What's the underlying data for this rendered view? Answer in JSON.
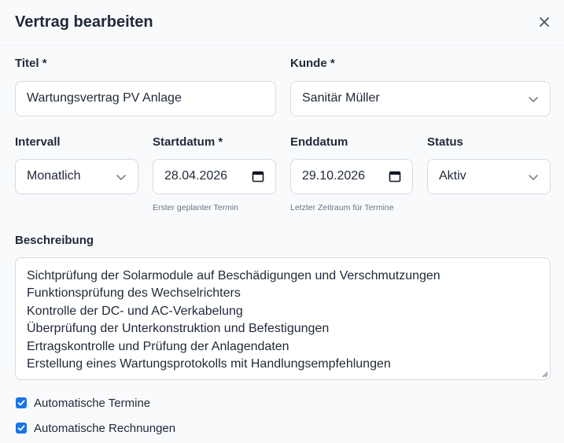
{
  "dialog": {
    "title": "Vertrag bearbeiten"
  },
  "form": {
    "titel": {
      "label": "Titel *",
      "value": "Wartungsvertrag PV Anlage"
    },
    "kunde": {
      "label": "Kunde *",
      "value": "Sanitär Müller"
    },
    "intervall": {
      "label": "Intervall",
      "value": "Monatlich"
    },
    "startdatum": {
      "label": "Startdatum *",
      "value": "28.04.2026",
      "hint": "Erster geplanter Termin"
    },
    "enddatum": {
      "label": "Enddatum",
      "value": "29.10.2026",
      "hint": "Letzter Zeitraum für Termine"
    },
    "status": {
      "label": "Status",
      "value": "Aktiv"
    },
    "beschreibung": {
      "label": "Beschreibung",
      "lines": [
        "Sichtprüfung der Solarmodule auf Beschädigungen und Verschmutzungen",
        "Funktionsprüfung des Wechselrichters",
        "Kontrolle der DC- und AC-Verkabelung",
        "Überprüfung der Unterkonstruktion und Befestigungen",
        "Ertragskontrolle und Prüfung der Anlagendaten",
        "Erstellung eines Wartungsprotokolls mit Handlungsempfehlungen"
      ]
    },
    "checkboxes": {
      "automatische_termine": {
        "label": "Automatische Termine",
        "checked": true
      },
      "automatische_rechnungen": {
        "label": "Automatische Rechnungen",
        "checked": true
      }
    }
  },
  "colors": {
    "accent": "#1a73e8",
    "border": "#d6dbe1",
    "background": "#f8fafc"
  },
  "icons": {
    "close": "close-icon",
    "dropdown": "chevron-down-icon",
    "date": "calendar-icon"
  }
}
